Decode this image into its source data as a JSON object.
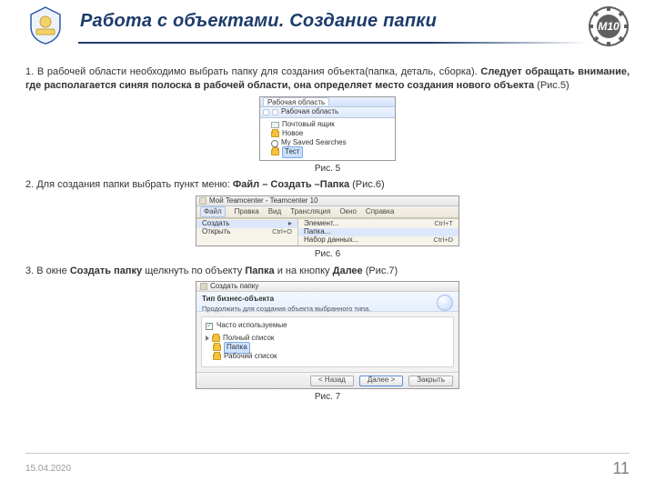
{
  "title": "Работа с объектами. Создание папки",
  "logos": {
    "left_label": "bmstu-crest",
    "right_label": "m10-gear-logo",
    "right_text": "М10"
  },
  "step1": {
    "prefix": "1. В рабочей области необходимо выбрать папку для создания объекта(папка, деталь, сборка). ",
    "bold": "Следует обращать внимание, где располагается синяя полоска в рабочей области, она определяет место создания нового объекта",
    "suffix": " (Рис.5)"
  },
  "fig5": {
    "caption": "Рис. 5",
    "tab": "Рабочая область",
    "header": "Рабочая область",
    "items": [
      {
        "icon": "mail",
        "label": "Почтовый ящик"
      },
      {
        "icon": "folder",
        "label": "Новое"
      },
      {
        "icon": "search",
        "label": "My Saved Searches"
      },
      {
        "icon": "folder",
        "label": "Тест",
        "selected": true
      }
    ]
  },
  "step2": {
    "prefix": "2. Для создания папки выбрать пункт меню: ",
    "bold": "Файл – Создать –Папка",
    "suffix": " (Рис.6)"
  },
  "fig6": {
    "caption": "Рис. 6",
    "window_title": "Мой Teamcenter - Teamcenter 10",
    "menus": [
      "Файл",
      "Правка",
      "Вид",
      "Трансляция",
      "Окно",
      "Справка"
    ],
    "open_menu_index": 0,
    "left_items": [
      {
        "label": "Создать",
        "has_sub": true,
        "hover": true
      },
      {
        "label": "Открыть",
        "hotkey": "Ctrl+O"
      }
    ],
    "right_items": [
      {
        "label": "Элемент...",
        "hotkey": "Ctrl+T"
      },
      {
        "label": "Папка...",
        "hover": true
      },
      {
        "label": "Набор данных...",
        "hotkey": "Ctrl+D"
      }
    ]
  },
  "step3": {
    "text_parts": [
      "3. В окне ",
      "Создать папку",
      " щелкнуть по объекту ",
      "Папка",
      " и на кнопку ",
      "Далее",
      " (Рис.7)"
    ]
  },
  "fig7": {
    "caption": "Рис. 7",
    "window_title": "Создать папку",
    "section_title": "Тип бизнес-объекта",
    "section_sub": "Продолжить для создания объекта выбранного типа.",
    "checkbox_label": "Часто используемые",
    "tree": [
      {
        "label": "Полный список",
        "root": true
      },
      {
        "label": "Папка",
        "selected": true
      },
      {
        "label": "Рабочий список"
      }
    ],
    "buttons": {
      "back": "< Назад",
      "next": "Далее >",
      "close": "Закрыть"
    }
  },
  "footer": {
    "date": "15.04.2020",
    "page": "11"
  }
}
